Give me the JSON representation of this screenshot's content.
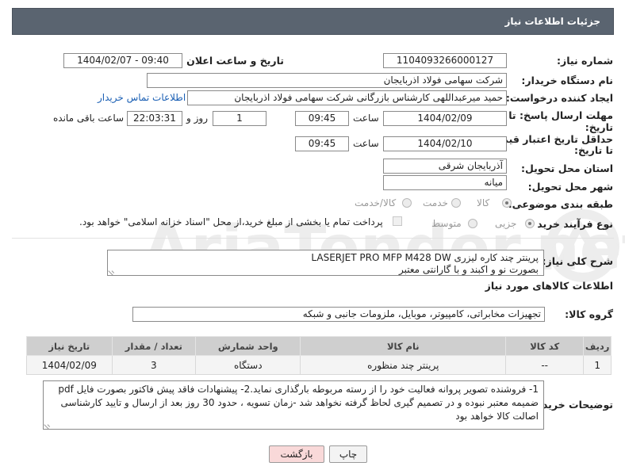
{
  "header": {
    "title": "جزئیات اطلاعات نیاز"
  },
  "labels": {
    "need_number": "شماره نیاز:",
    "announce_datetime": "تاریخ و ساعت اعلان عمومی:",
    "buyer_org": "نام دستگاه خریدار:",
    "requester": "ایجاد کننده درخواست:",
    "reply_deadline": "مهلت ارسال پاسخ: تا تاریخ:",
    "time": "ساعت",
    "day_and": "روز و",
    "remaining": "ساعت باقی مانده",
    "price_validity": "حداقل تاریخ اعتبار قیمت: تا تاریخ:",
    "delivery_province": "استان محل تحویل:",
    "delivery_city": "شهر محل تحویل:",
    "category": "طبقه بندی موضوعی:",
    "purchase_type": "نوع فرآیند خرید :",
    "need_desc": "شرح کلی نیاز:",
    "goods_info": "اطلاعات کالاهای مورد نیاز",
    "goods_group": "گروه کالا:",
    "buyer_notes": "توضیحات خریدار:"
  },
  "fields": {
    "need_number": "1104093266000127",
    "announce_datetime": "1404/02/07 - 09:40",
    "buyer_org": "شرکت سهامی فولاد اذربایجان",
    "requester": "حمید میرعبداللهی کارشناس بازرگانی شرکت سهامی فولاد اذربایجان",
    "contact_link": "اطلاعات تماس خریدار",
    "reply_date": "1404/02/09",
    "reply_time": "09:45",
    "reply_days": "1",
    "reply_remaining": "22:03:31",
    "validity_date": "1404/02/10",
    "validity_time": "09:45",
    "province": "آذربایجان شرقی",
    "city": "میانه",
    "goods_group": "تجهیزات مخابراتی، کامپیوتر، موبایل، ملزومات جانبی و شبکه"
  },
  "category_options": [
    {
      "label": "کالا",
      "selected": true
    },
    {
      "label": "خدمت",
      "selected": false
    },
    {
      "label": "کالا/خدمت",
      "selected": false
    }
  ],
  "purchase_options": [
    {
      "label": "جزیی",
      "selected": true
    },
    {
      "label": "متوسط",
      "selected": false
    }
  ],
  "payment_note": "پرداخت تمام یا بخشی از مبلغ خرید،از محل \"اسناد خزانه اسلامی\" خواهد بود.",
  "need_description": {
    "line1": "پرینتر چند کاره لیزری LASERJET PRO MFP M428 DW",
    "line2": "بصورت نو و اکبند و با گارانتی معتبر"
  },
  "table": {
    "headers": [
      "ردیف",
      "کد کالا",
      "نام کالا",
      "واحد شمارش",
      "تعداد / مقدار",
      "تاریخ نیاز"
    ],
    "rows": [
      [
        "1",
        "--",
        "پرینتر چند منظوره",
        "دستگاه",
        "3",
        "1404/02/09"
      ]
    ]
  },
  "buyer_notes": "1- فروشنده تصویر پروانه فعالیت خود را از رسته مربوطه بارگذاری نماید.2- پیشنهادات فاقد پیش فاکتور بصورت فایل pdf ضمیمه معتبر نبوده و در تصمیم گیری لحاظ گرفته نخواهد شد -زمان تسویه ، حدود 30 روز بعد از ارسال و تایید کارشناسی اصالت کالا خواهد بود",
  "buttons": {
    "print": "چاپ",
    "back": "بازگشت"
  },
  "colors": {
    "header_bg": "#5a6470",
    "link": "#1a5fb4",
    "back_button_bg": "#f9d9d9"
  }
}
